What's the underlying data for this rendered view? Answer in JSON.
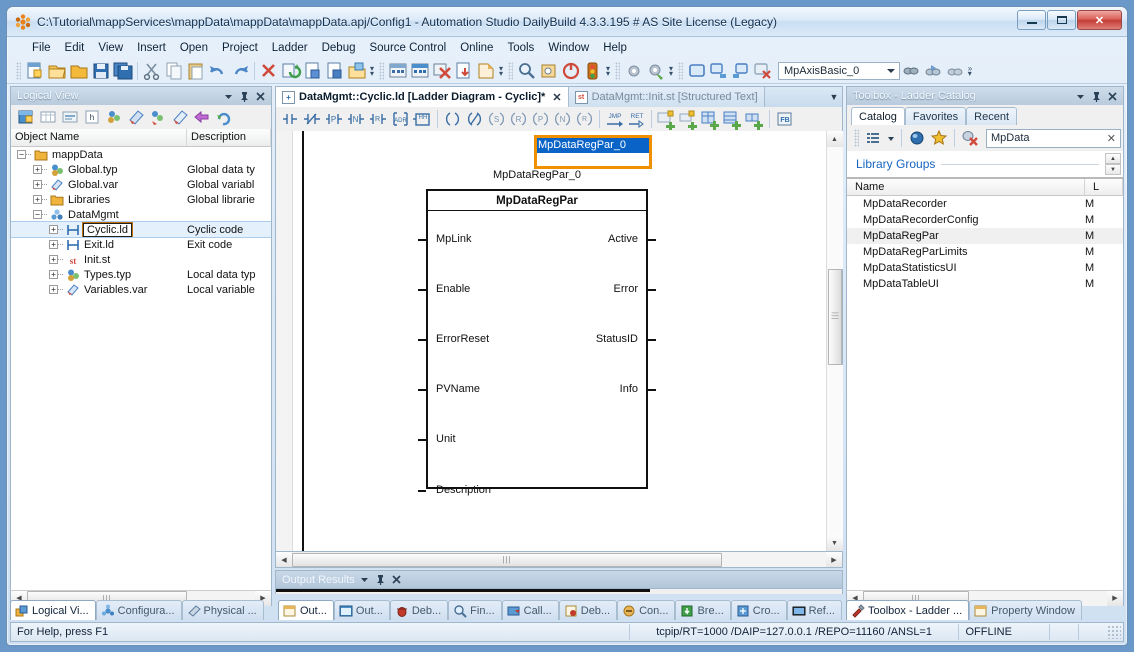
{
  "window": {
    "title": "C:\\Tutorial\\mappServices\\mappData\\mappData\\mappData.apj/Config1 - Automation Studio DailyBuild 4.3.3.195 # AS Site License (Legacy)",
    "minimize_label": "",
    "maximize_label": "",
    "close_label": "✕"
  },
  "menu": {
    "items": [
      "File",
      "Edit",
      "View",
      "Insert",
      "Open",
      "Project",
      "Ladder",
      "Debug",
      "Source Control",
      "Online",
      "Tools",
      "Window",
      "Help"
    ]
  },
  "toolbar": {
    "groups": [
      {
        "icons": [
          "new-file-icon",
          "open-project-icon",
          "open-folder-icon",
          "save-icon",
          "save-all-icon"
        ]
      },
      {
        "icons": [
          "cut-icon",
          "copy-icon",
          "paste-icon",
          "undo-icon",
          "redo-icon"
        ]
      },
      {
        "icons": [
          "delete-icon",
          "build-icon",
          "rebuild-icon",
          "build-config-icon",
          "transfer-icon"
        ]
      },
      {
        "icons": [
          "simulation-icon",
          "simulation-stop-icon",
          "remove-icon",
          "download-icon",
          "offline-install-icon"
        ]
      },
      {
        "icons": [
          "find-icon",
          "watch-icon",
          "power-icon",
          "traffic-light-icon"
        ]
      },
      {
        "icons": [
          "settings-gear-icon",
          "settings-gear-green-icon"
        ]
      },
      {
        "icons": [
          "window-icon",
          "window-right-icon",
          "window-left-icon",
          "window-close-icon"
        ]
      }
    ],
    "combo": {
      "value": "MpAxisBasic_0",
      "icon": "chevron-down-icon"
    },
    "trailing_icons": [
      "monitor-icon",
      "monitor-blue-icon",
      "monitor-grey-icon"
    ]
  },
  "left_panel": {
    "caption": "Logical View",
    "caption_buttons": [
      "chevron-down-icon",
      "pin-icon",
      "close-icon"
    ],
    "toolbar_icons": [
      "add-object-icon",
      "table-icon",
      "properties-icon",
      "header-icon",
      "data-type-icon",
      "variable-icon",
      "data-type-add-icon",
      "variable-add-icon",
      "transfer-icon",
      "refresh-icon"
    ],
    "columns": [
      "Object Name",
      "Description"
    ],
    "tree": [
      {
        "label": "mappData",
        "desc": "",
        "depth": 0,
        "icon": "folder-icon",
        "expander": "-",
        "selected": false
      },
      {
        "label": "Global.typ",
        "desc": "Global data ty",
        "depth": 1,
        "icon": "data-type-icon",
        "expander": "+",
        "selected": false
      },
      {
        "label": "Global.var",
        "desc": "Global variabl",
        "depth": 1,
        "icon": "variable-icon",
        "expander": "+",
        "selected": false
      },
      {
        "label": "Libraries",
        "desc": "Global librarie",
        "depth": 1,
        "icon": "folder-icon",
        "expander": "+",
        "selected": false
      },
      {
        "label": "DataMgmt",
        "desc": "",
        "depth": 1,
        "icon": "program-icon",
        "expander": "-",
        "selected": false
      },
      {
        "label": "Cyclic.ld",
        "desc": "Cyclic code",
        "depth": 2,
        "icon": "ladder-icon",
        "expander": "+",
        "selected": true
      },
      {
        "label": "Exit.ld",
        "desc": "Exit code",
        "depth": 2,
        "icon": "ladder-icon",
        "expander": "+",
        "selected": false
      },
      {
        "label": "Init.st",
        "desc": "",
        "depth": 2,
        "icon": "st-icon",
        "expander": "+",
        "selected": false
      },
      {
        "label": "Types.typ",
        "desc": "Local data typ",
        "depth": 2,
        "icon": "data-type-icon",
        "expander": "+",
        "selected": false
      },
      {
        "label": "Variables.var",
        "desc": "Local variable",
        "depth": 2,
        "icon": "variable-icon",
        "expander": "+",
        "selected": false
      }
    ],
    "dock_tabs": [
      {
        "label": "Logical Vi...",
        "icon": "logical-view-icon",
        "active": true
      },
      {
        "label": "Configura...",
        "icon": "configuration-icon",
        "active": false
      },
      {
        "label": "Physical ...",
        "icon": "physical-view-icon",
        "active": false
      }
    ]
  },
  "editor": {
    "tabs": [
      {
        "label": "DataMgmt::Cyclic.ld [Ladder Diagram - Cyclic]*",
        "icon": "ladder-icon",
        "active": true,
        "close": "✕"
      },
      {
        "label": "DataMgmt::Init.st [Structured Text]",
        "icon": "st-icon",
        "active": false,
        "close": ""
      }
    ],
    "tab_overflow_icon": "chevron-down-icon",
    "toolbar_icons": [
      "contact-no-icon",
      "contact-nc-icon",
      "contact-p-icon",
      "contact-n-icon",
      "contact-rn-icon",
      "contact-adr-icon",
      "contact-hh-icon",
      "coil-icon",
      "coil-not-icon",
      "coil-set-icon",
      "coil-reset-icon",
      "coil-p-icon",
      "coil-n-icon",
      "coil-rn-icon",
      "jump-icon",
      "return-icon",
      "add-row-icon",
      "remove-row-icon",
      "add-network-icon",
      "add-network-below-icon",
      "add-branch-icon",
      "function-block-icon"
    ],
    "function_block": {
      "instance_name": "MpDataRegPar_0",
      "edit_value": "MpDataRegPar_0",
      "type_name": "MpDataRegPar",
      "inputs": [
        "MpLink",
        "Enable",
        "ErrorReset",
        "PVName",
        "Unit",
        "Description"
      ],
      "outputs": [
        "Active",
        "Error",
        "StatusID",
        "Info"
      ]
    },
    "scrollbar_thumb_icon": "grip-icon"
  },
  "output_panel": {
    "caption": "Output Results",
    "caption_buttons": [
      "chevron-down-icon",
      "pin-icon",
      "close-icon"
    ],
    "dock_tabs": [
      {
        "label": "Out...",
        "icon": "output-icon",
        "active": true
      },
      {
        "label": "Out...",
        "icon": "output-table-icon",
        "active": false
      },
      {
        "label": "Deb...",
        "icon": "debugger-icon",
        "active": false
      },
      {
        "label": "Fin...",
        "icon": "find-icon",
        "active": false
      },
      {
        "label": "Call...",
        "icon": "call-stack-icon",
        "active": false
      },
      {
        "label": "Deb...",
        "icon": "debug-icon",
        "active": false
      },
      {
        "label": "Con...",
        "icon": "console-icon",
        "active": false
      },
      {
        "label": "Bre...",
        "icon": "breakpoints-icon",
        "active": false
      },
      {
        "label": "Cro...",
        "icon": "cross-reference-icon",
        "active": false
      },
      {
        "label": "Ref...",
        "icon": "references-icon",
        "active": false
      }
    ]
  },
  "right_panel": {
    "caption": "Toolbox - Ladder Catalog",
    "caption_buttons": [
      "chevron-down-icon",
      "pin-icon",
      "close-icon"
    ],
    "tabs": [
      {
        "label": "Catalog",
        "active": true
      },
      {
        "label": "Favorites",
        "active": false
      },
      {
        "label": "Recent",
        "active": false
      }
    ],
    "toolbar_icons": [
      "view-list-icon",
      "chevron-down-icon",
      "library-icon",
      "favorite-star-icon",
      "clear-filter-icon"
    ],
    "search": {
      "value": "MpData",
      "clear_icon": "close-icon"
    },
    "group_label": "Library Groups",
    "spinner_icons": [
      "chevron-up-icon",
      "chevron-down-icon"
    ],
    "columns": [
      "Name",
      "L"
    ],
    "rows": [
      {
        "name": "MpDataRecorder",
        "lib": "M",
        "selected": false
      },
      {
        "name": "MpDataRecorderConfig",
        "lib": "M",
        "selected": false
      },
      {
        "name": "MpDataRegPar",
        "lib": "M",
        "selected": true
      },
      {
        "name": "MpDataRegParLimits",
        "lib": "M",
        "selected": false
      },
      {
        "name": "MpDataStatisticsUI",
        "lib": "M",
        "selected": false
      },
      {
        "name": "MpDataTableUI",
        "lib": "M",
        "selected": false
      }
    ],
    "dock_tabs": [
      {
        "label": "Toolbox - Ladder ...",
        "icon": "toolbox-icon",
        "active": true
      },
      {
        "label": "Property Window",
        "icon": "property-icon",
        "active": false
      }
    ]
  },
  "status_bar": {
    "help": "For Help, press F1",
    "connection": "tcpip/RT=1000 /DAIP=127.0.0.1 /REPO=11160 /ANSL=1",
    "state": "OFFLINE"
  },
  "colors": {
    "accent_orange": "#f09000",
    "selection_blue": "#0a64c8",
    "link_blue": "#1565c0",
    "window_chrome": "#cfe0f2"
  }
}
